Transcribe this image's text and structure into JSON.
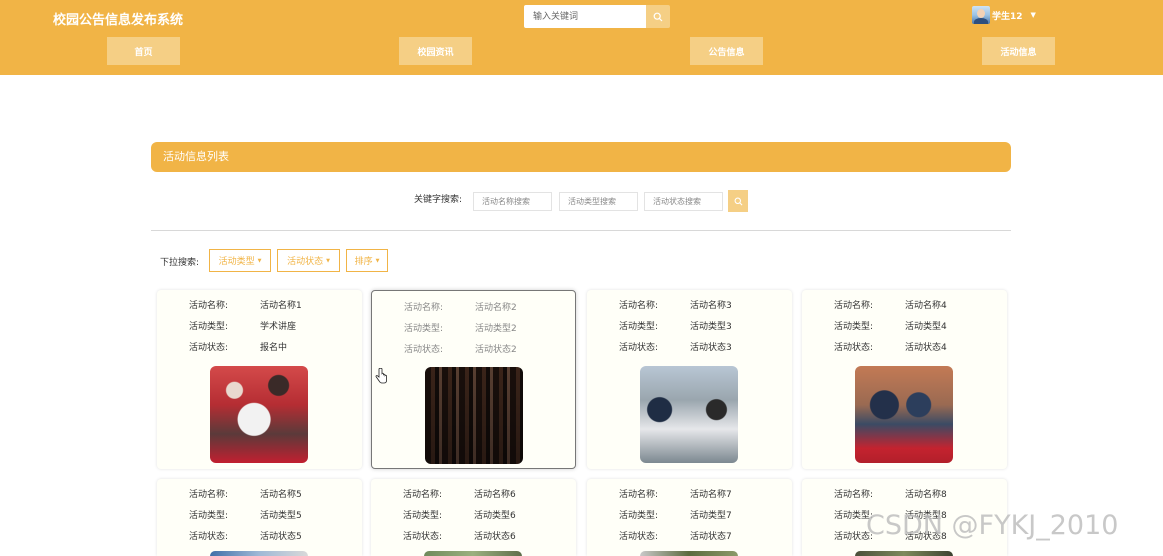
{
  "header": {
    "site_title": "校园公告信息发布系统",
    "search_placeholder": "输入关键词",
    "user_name": "学生12",
    "nav": [
      "首页",
      "校园资讯",
      "公告信息",
      "活动信息"
    ],
    "accent_color": "#f1b446"
  },
  "section": {
    "title": "活动信息列表",
    "keyword_label": "关键字搜索:",
    "search_inputs": [
      "活动名称搜索",
      "活动类型搜索",
      "活动状态搜索"
    ],
    "dropdown_label": "下拉搜索:",
    "dropdowns": [
      "活动类型",
      "活动状态",
      "排序"
    ]
  },
  "card_labels": {
    "name": "活动名称:",
    "type": "活动类型:",
    "status": "活动状态:"
  },
  "cards": [
    {
      "name": "活动名称1",
      "type": "学术讲座",
      "status": "报名中"
    },
    {
      "name": "活动名称2",
      "type": "活动类型2",
      "status": "活动状态2"
    },
    {
      "name": "活动名称3",
      "type": "活动类型3",
      "status": "活动状态3"
    },
    {
      "name": "活动名称4",
      "type": "活动类型4",
      "status": "活动状态4"
    },
    {
      "name": "活动名称5",
      "type": "活动类型5",
      "status": "活动状态5"
    },
    {
      "name": "活动名称6",
      "type": "活动类型6",
      "status": "活动状态6"
    },
    {
      "name": "活动名称7",
      "type": "活动类型7",
      "status": "活动状态7"
    },
    {
      "name": "活动名称8",
      "type": "活动类型8",
      "status": "活动状态8"
    }
  ],
  "watermark": "CSDN @FYKJ_2010"
}
